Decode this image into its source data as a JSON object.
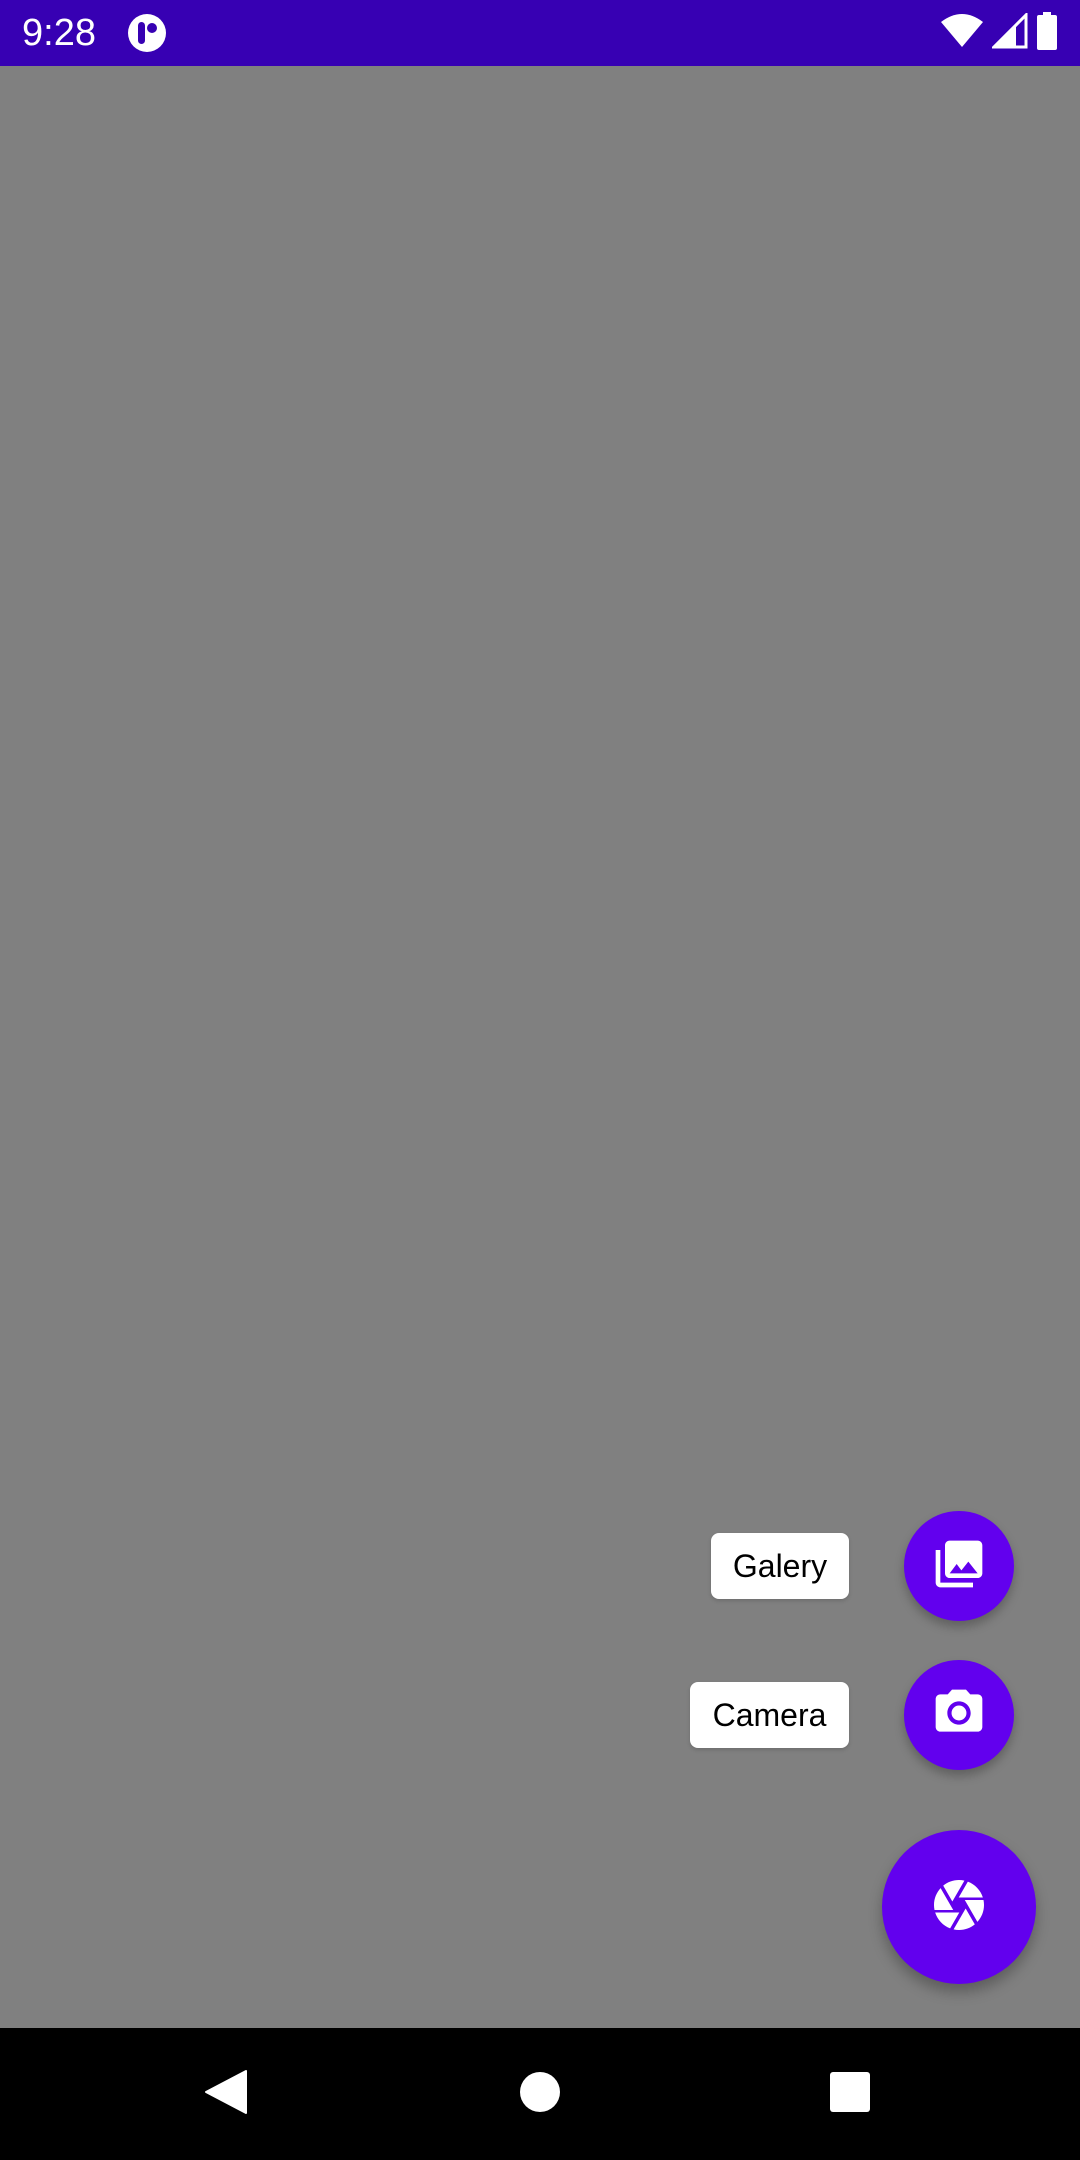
{
  "status_bar": {
    "time": "9:28",
    "background_color": "#3700B3",
    "app_icon": "notification-app-icon",
    "right_icons": [
      "wifi-icon",
      "cell-signal-icon",
      "battery-icon"
    ]
  },
  "content": {
    "background_color": "#808080"
  },
  "fab_menu": {
    "accent_color": "#6200EE",
    "items": [
      {
        "label": "Galery",
        "icon": "photo-library-icon"
      },
      {
        "label": "Camera",
        "icon": "camera-icon"
      }
    ],
    "main_icon": "camera-shutter-icon"
  },
  "nav_bar": {
    "background_color": "#000000",
    "buttons": [
      "back-icon",
      "home-icon",
      "recents-icon"
    ]
  }
}
